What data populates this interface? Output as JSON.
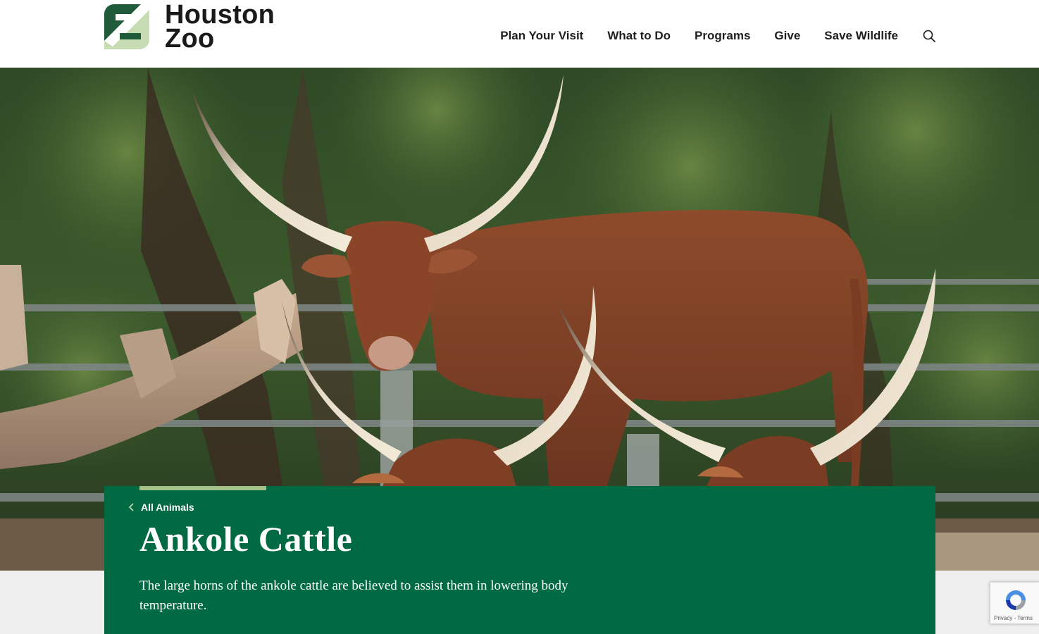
{
  "brand": {
    "name_line1": "Houston",
    "name_line2": "Zoo",
    "logo_dark": "#1f5b3b",
    "logo_light": "#c7dcb2"
  },
  "nav": {
    "items": [
      {
        "label": "Plan Your Visit"
      },
      {
        "label": "What to Do"
      },
      {
        "label": "Programs"
      },
      {
        "label": "Give"
      },
      {
        "label": "Save Wildlife"
      }
    ],
    "search_icon": "search-icon"
  },
  "hero": {
    "image_subject": "ankole-cattle-photo"
  },
  "card": {
    "back_link": "All Animals",
    "title": "Ankole Cattle",
    "description": "The large horns of the ankole cattle are believed to assist them in lowering body temperature.",
    "background": "#006a43",
    "accent": "#a4c38a"
  },
  "recaptcha": {
    "links": "Privacy - Terms"
  }
}
